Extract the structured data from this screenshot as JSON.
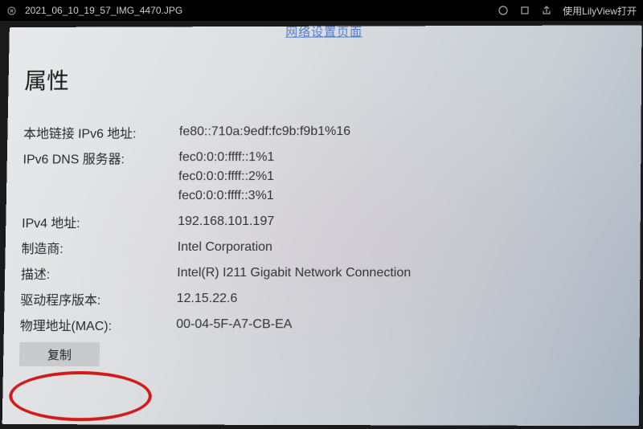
{
  "titlebar": {
    "filename": "2021_06_10_19_57_IMG_4470.JPG",
    "open_with_prefix": "使用",
    "open_with_app": "LilyView",
    "open_with_suffix": "打开"
  },
  "cropped_link": "网络设置页面",
  "properties": {
    "title": "属性",
    "rows": {
      "ipv6_local": {
        "label": "本地链接 IPv6 地址:",
        "value": "fe80::710a:9edf:fc9b:f9b1%16"
      },
      "ipv6_dns": {
        "label": "IPv6 DNS 服务器:",
        "values": [
          "fec0:0:0:ffff::1%1",
          "fec0:0:0:ffff::2%1",
          "fec0:0:0:ffff::3%1"
        ]
      },
      "ipv4": {
        "label": "IPv4 地址:",
        "value": "192.168.101.197"
      },
      "mfr": {
        "label": "制造商:",
        "value": "Intel Corporation"
      },
      "desc": {
        "label": "描述:",
        "value": "Intel(R) I211 Gigabit Network Connection"
      },
      "driver": {
        "label": "驱动程序版本:",
        "value": "12.15.22.6"
      },
      "mac": {
        "label": "物理地址(MAC):",
        "value": "00-04-5F-A7-CB-EA"
      }
    },
    "copy_label": "复制"
  }
}
